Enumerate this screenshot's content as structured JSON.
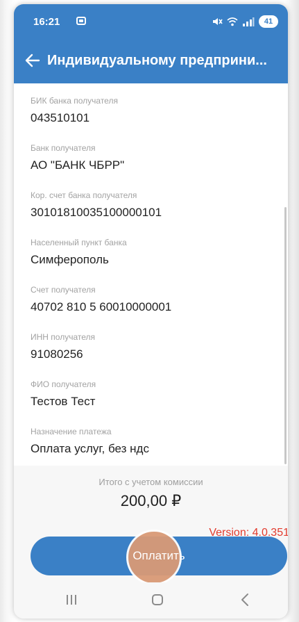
{
  "status_bar": {
    "time": "16:21",
    "battery": "41",
    "icons": [
      "screen-record-icon",
      "mute-icon",
      "wifi-icon",
      "signal-icon",
      "battery-icon"
    ]
  },
  "app_bar": {
    "title": "Индивидуальному предприни..."
  },
  "fields": [
    {
      "label": "БИК банка получателя",
      "value": "043510101"
    },
    {
      "label": "Банк получателя",
      "value": "АО \"БАНК ЧБРР\""
    },
    {
      "label": "Кор. счет банка получателя",
      "value": "30101810035100000101"
    },
    {
      "label": "Населенный пункт банка",
      "value": "Симферополь"
    },
    {
      "label": "Счет получателя",
      "value": "40702 810 5 60010000001"
    },
    {
      "label": "ИНН получателя",
      "value": "91080256"
    },
    {
      "label": "ФИО получателя",
      "value": "Тестов Тест"
    },
    {
      "label": "Назначение платежа",
      "value": "Оплата услуг, без ндс"
    }
  ],
  "summary": {
    "total_label": "Итого с учетом комиссии",
    "total_amount": "200,00 ₽",
    "version": "Version: 4.0.351"
  },
  "actions": {
    "pay_label": "Оплатить"
  },
  "colors": {
    "primary": "#3a80c6",
    "version_text": "#e23b2e",
    "touch_indicator": "#d99a76"
  }
}
